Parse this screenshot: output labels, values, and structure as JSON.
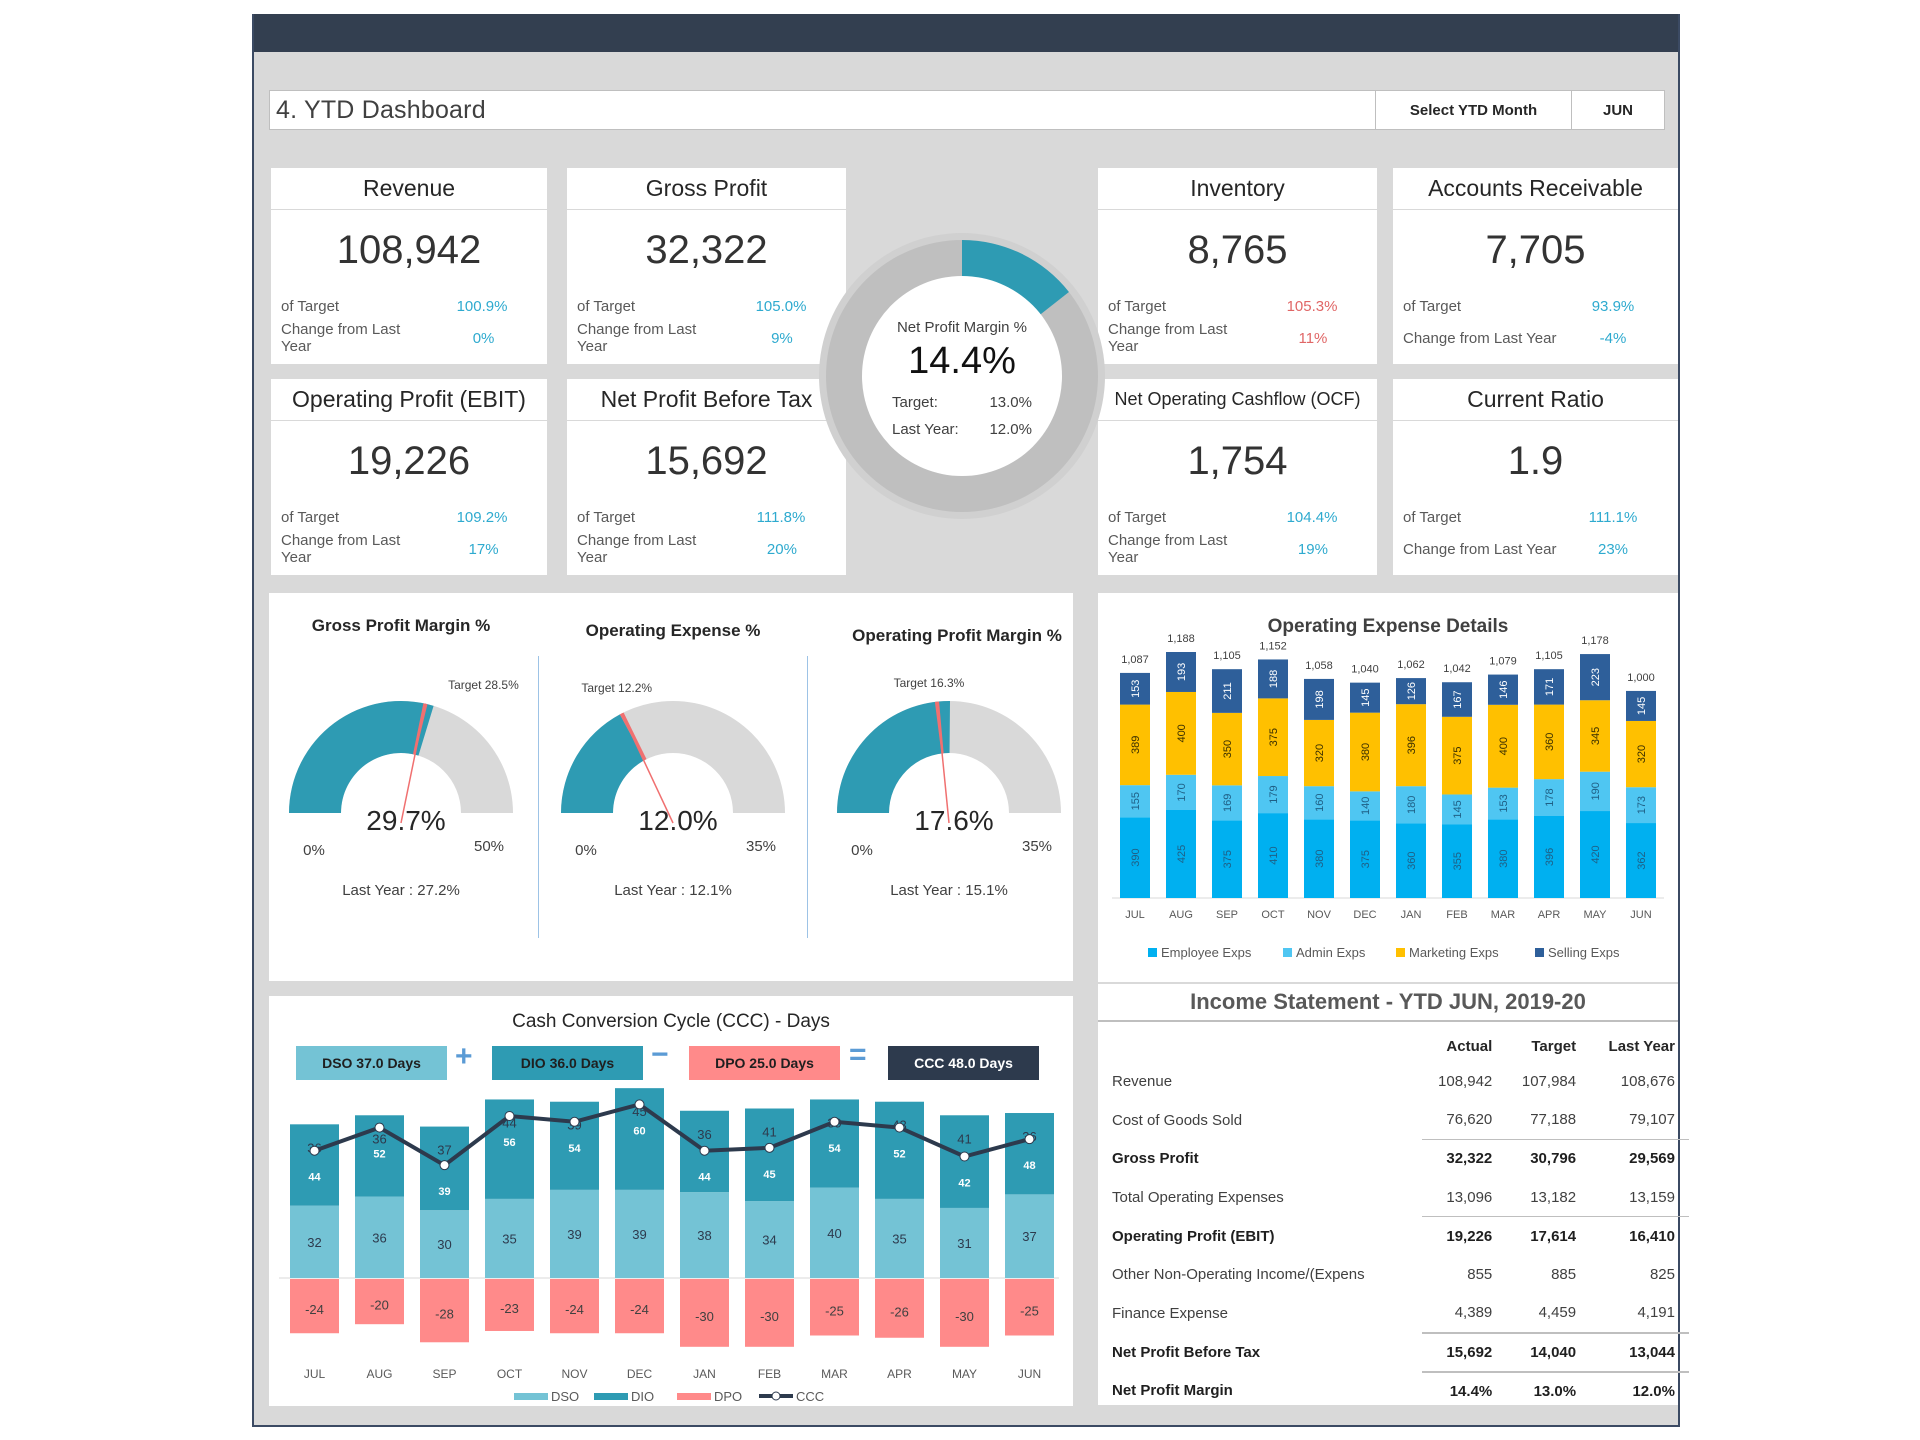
{
  "header": {
    "title": "4. YTD Dashboard",
    "select_label": "Select YTD Month",
    "select_value": "JUN"
  },
  "kpis": {
    "revenue": {
      "title": "Revenue",
      "value": "108,942",
      "target_label": "of Target",
      "target": "100.9%",
      "change_label": "Change from Last Year",
      "change": "0%"
    },
    "gross_profit": {
      "title": "Gross Profit",
      "value": "32,322",
      "target_label": "of Target",
      "target": "105.0%",
      "change_label": "Change from Last Year",
      "change": "9%"
    },
    "ebit": {
      "title": "Operating Profit (EBIT)",
      "value": "19,226",
      "target_label": "of Target",
      "target": "109.2%",
      "change_label": "Change from Last Year",
      "change": "17%"
    },
    "npbt": {
      "title": "Net Profit Before Tax",
      "value": "15,692",
      "target_label": "of Target",
      "target": "111.8%",
      "change_label": "Change from Last Year",
      "change": "20%"
    },
    "inventory": {
      "title": "Inventory",
      "value": "8,765",
      "target_label": "of Target",
      "target": "105.3%",
      "change_label": "Change from Last Year",
      "change": "11%"
    },
    "ar": {
      "title": "Accounts Receivable",
      "value": "7,705",
      "target_label": "of Target",
      "target": "93.9%",
      "change_label": "Change from Last Year",
      "change": "-4%"
    },
    "ocf": {
      "title": "Net Operating Cashflow (OCF)",
      "value": "1,754",
      "target_label": "of Target",
      "target": "104.4%",
      "change_label": "Change from Last Year",
      "change": "19%"
    },
    "current_ratio": {
      "title": "Current Ratio",
      "value": "1.9",
      "target_label": "of Target",
      "target": "111.1%",
      "change_label": "Change from Last Year",
      "change": "23%"
    }
  },
  "net_profit_margin": {
    "label": "Net Profit Margin %",
    "value": "14.4%",
    "value_pct": 14.4,
    "target_label": "Target:",
    "target": "13.0%",
    "last_year_label": "Last Year:",
    "last_year": "12.0%"
  },
  "gauges": [
    {
      "title": "Gross Profit Margin %",
      "value_label": "29.7%",
      "value": 29.7,
      "target": 28.5,
      "target_label": "Target 28.5%",
      "min_label": "0%",
      "max_label": "50%",
      "max": 50,
      "last_year_label": "Last Year : 27.2%"
    },
    {
      "title": "Operating Expense %",
      "value_label": "12.0%",
      "value": 12.0,
      "target": 12.2,
      "target_label": "Target 12.2%",
      "min_label": "0%",
      "max_label": "35%",
      "max": 35,
      "last_year_label": "Last Year : 12.1%"
    },
    {
      "title": "Operating Profit Margin %",
      "value_label": "17.6%",
      "value": 17.6,
      "target": 16.3,
      "target_label": "Target 16.3%",
      "min_label": "0%",
      "max_label": "35%",
      "max": 35,
      "last_year_label": "Last Year : 15.1%"
    }
  ],
  "colors": {
    "teal": "#2e9bb3",
    "gauge_bg": "#d9d9d9",
    "target_marker": "#f07070",
    "donut_bg": "#bfbfbf",
    "employee": "#00b0f0",
    "admin": "#4fc6f2",
    "marketing": "#ffc000",
    "selling": "#2e5f9a",
    "dso": "#74c3d5",
    "dio": "#2e9bb3",
    "dpo": "#ff8a8a",
    "ccc": "#2d3a4d"
  },
  "chart_data": [
    {
      "type": "bar",
      "stacked": true,
      "title": "Operating Expense Details",
      "categories": [
        "JUL",
        "AUG",
        "SEP",
        "OCT",
        "NOV",
        "DEC",
        "JAN",
        "FEB",
        "MAR",
        "APR",
        "MAY",
        "JUN"
      ],
      "series": [
        {
          "name": "Employee Exps",
          "values": [
            390,
            425,
            375,
            410,
            380,
            375,
            360,
            355,
            380,
            396,
            420,
            362
          ]
        },
        {
          "name": "Admin Exps",
          "values": [
            155,
            170,
            169,
            179,
            160,
            140,
            180,
            145,
            153,
            178,
            190,
            173
          ]
        },
        {
          "name": "Marketing Exps",
          "values": [
            389,
            400,
            350,
            375,
            320,
            380,
            396,
            375,
            400,
            360,
            345,
            320
          ]
        },
        {
          "name": "Selling Exps",
          "values": [
            153,
            193,
            211,
            188,
            198,
            145,
            126,
            167,
            146,
            171,
            223,
            145
          ]
        }
      ],
      "totals": [
        1087,
        1188,
        1105,
        1152,
        1058,
        1040,
        1062,
        1042,
        1079,
        1105,
        1178,
        1000
      ],
      "total_labels": [
        "1,087",
        "1,188",
        "1,105",
        "1,152",
        "1,058",
        "1,040",
        "1,062",
        "1,042",
        "1,079",
        "1,105",
        "1,178",
        "1,000"
      ],
      "legend": "bottom",
      "ylim": [
        0,
        1300
      ]
    },
    {
      "type": "bar",
      "stacked": true,
      "title": "Cash Conversion Cycle (CCC) - Days",
      "categories": [
        "JUL",
        "AUG",
        "SEP",
        "OCT",
        "NOV",
        "DEC",
        "JAN",
        "FEB",
        "MAR",
        "APR",
        "MAY",
        "JUN"
      ],
      "series": [
        {
          "name": "DSO",
          "values": [
            32,
            36,
            30,
            35,
            39,
            39,
            38,
            34,
            40,
            35,
            31,
            37
          ]
        },
        {
          "name": "DIO",
          "values": [
            36,
            36,
            37,
            44,
            39,
            45,
            36,
            41,
            39,
            43,
            41,
            36
          ]
        },
        {
          "name": "DPO",
          "values": [
            -24,
            -20,
            -28,
            -23,
            -24,
            -24,
            -30,
            -30,
            -25,
            -26,
            -30,
            -25
          ]
        },
        {
          "name": "CCC",
          "type": "line",
          "values": [
            44,
            52,
            39,
            56,
            54,
            60,
            44,
            45,
            54,
            52,
            42,
            48
          ]
        }
      ],
      "legend": "bottom",
      "ylim": [
        -35,
        85
      ]
    }
  ],
  "ccc_summary": {
    "dso": "DSO 37.0 Days",
    "plus": "+",
    "dio": "DIO 36.0 Days",
    "minus": "−",
    "dpo": "DPO 25.0 Days",
    "equals": "=",
    "ccc": "CCC 48.0 Days"
  },
  "income_statement": {
    "title": "Income Statement - YTD JUN, 2019-20",
    "columns": [
      "Actual",
      "Target",
      "Last Year"
    ],
    "rows": [
      {
        "name": "Revenue",
        "actual": "108,942",
        "target": "107,984",
        "last_year": "108,676"
      },
      {
        "name": "Cost of Goods Sold",
        "actual": "76,620",
        "target": "77,188",
        "last_year": "79,107"
      },
      {
        "name": "Gross Profit",
        "actual": "32,322",
        "target": "30,796",
        "last_year": "29,569"
      },
      {
        "name": "Total Operating Expenses",
        "actual": "13,096",
        "target": "13,182",
        "last_year": "13,159"
      },
      {
        "name": "Operating Profit (EBIT)",
        "actual": "19,226",
        "target": "17,614",
        "last_year": "16,410"
      },
      {
        "name": "Other Non-Operating Income/(Expens",
        "actual": "855",
        "target": "885",
        "last_year": "825"
      },
      {
        "name": "Finance Expense",
        "actual": "4,389",
        "target": "4,459",
        "last_year": "4,191"
      },
      {
        "name": "Net Profit Before Tax",
        "actual": "15,692",
        "target": "14,040",
        "last_year": "13,044"
      },
      {
        "name": "Net Profit Margin",
        "actual": "14.4%",
        "target": "13.0%",
        "last_year": "12.0%"
      }
    ]
  }
}
